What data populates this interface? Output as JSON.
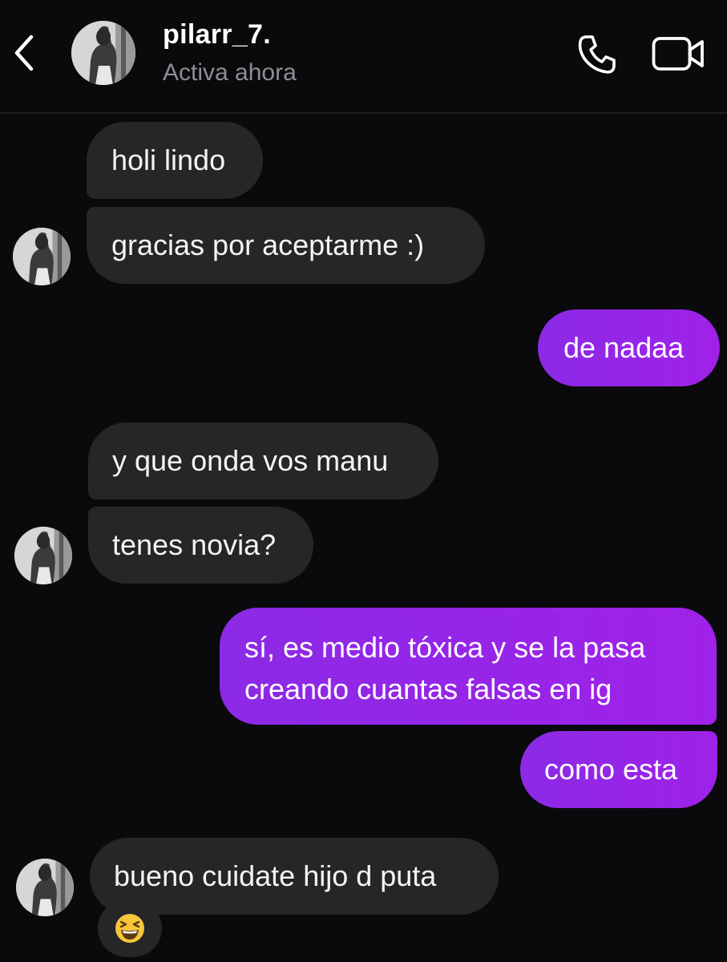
{
  "header": {
    "username": "pilarr_7.",
    "status": "Activa ahora",
    "back_icon": "chevron-left-icon",
    "call_icon": "phone-icon",
    "video_icon": "video-camera-icon"
  },
  "messages": [
    {
      "direction": "incoming",
      "text": "holi lindo"
    },
    {
      "direction": "incoming",
      "text": "gracias por aceptarme :)"
    },
    {
      "direction": "outgoing",
      "text": "de nadaa"
    },
    {
      "direction": "incoming",
      "text": "y que onda vos manu"
    },
    {
      "direction": "incoming",
      "text": "tenes novia?"
    },
    {
      "direction": "outgoing",
      "line1": "sí, es medio tóxica y se la pasa",
      "line2": "creando cuantas falsas en ig"
    },
    {
      "direction": "outgoing",
      "text": "como esta"
    },
    {
      "direction": "incoming",
      "text": "bueno cuidate hijo d puta"
    }
  ],
  "reaction": {
    "emoji": "😆",
    "icon": "laughing-face-icon"
  },
  "colors": {
    "background": "#0a0a0c",
    "incoming_bubble": "#262629",
    "outgoing_bubble": "#9a24e6",
    "secondary_text": "#8e8e93"
  }
}
